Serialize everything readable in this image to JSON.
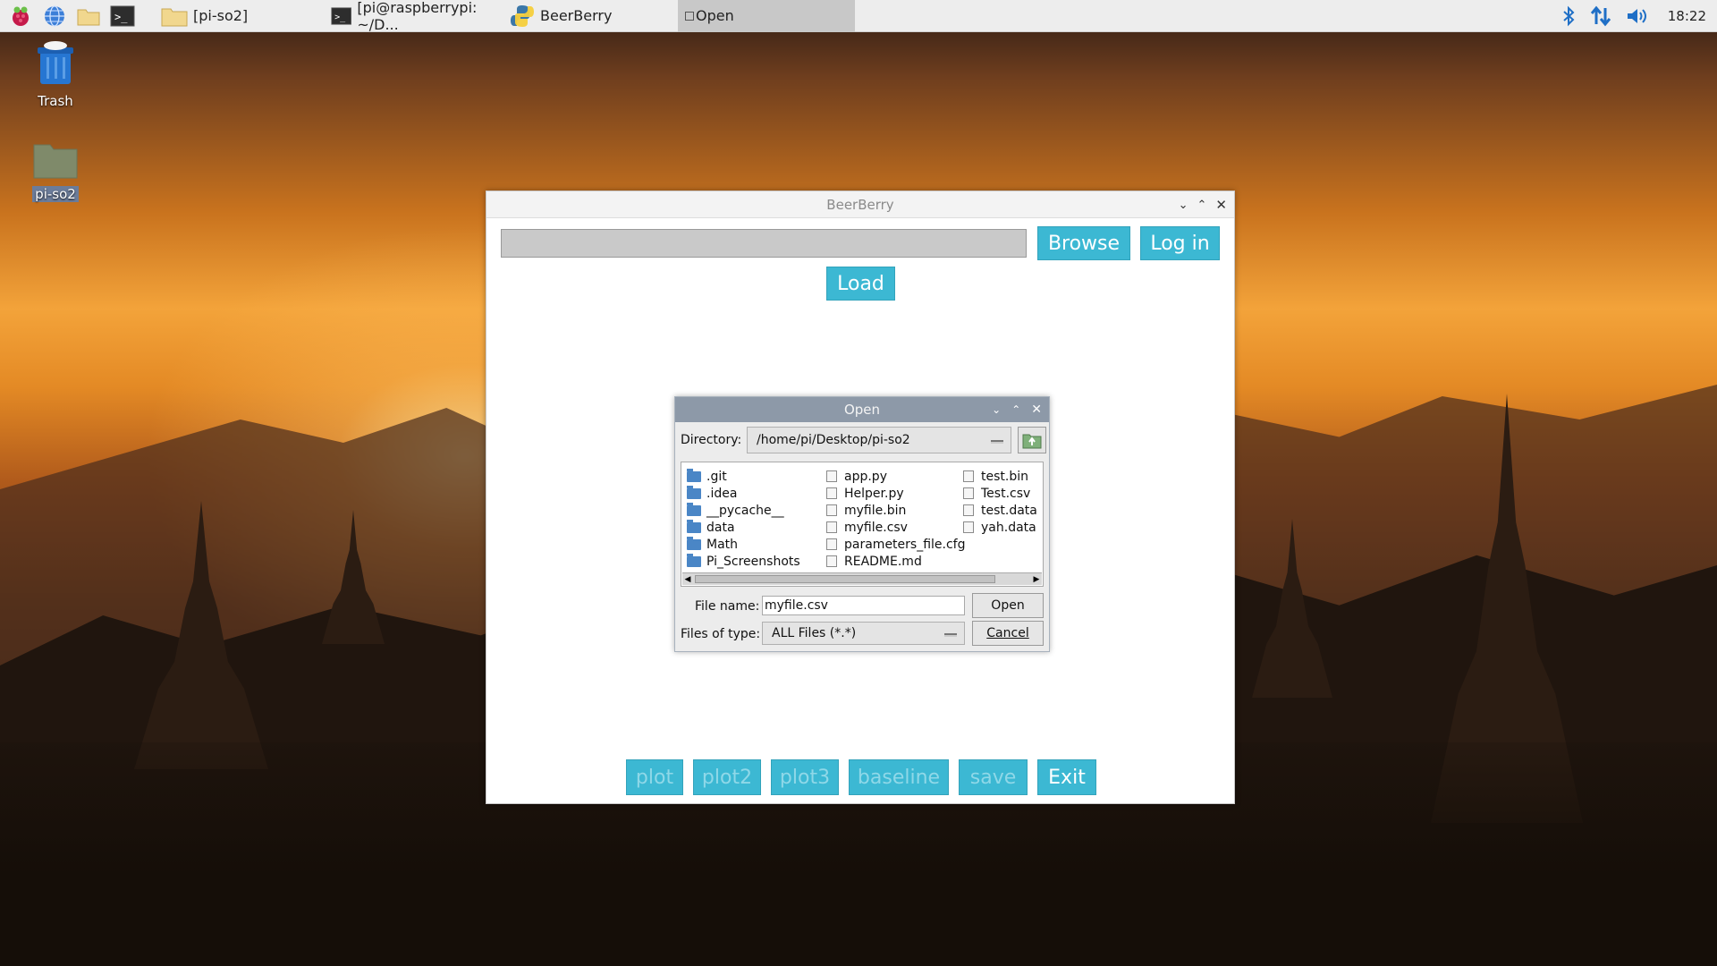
{
  "taskbar": {
    "tasks": [
      {
        "label": "[pi-so2]",
        "icon": "folder-icon"
      },
      {
        "label": "[pi@raspberrypi: ~/D...",
        "icon": "terminal-icon"
      },
      {
        "label": "BeerBerry",
        "icon": "python-icon"
      },
      {
        "label": "Open",
        "icon": "window-icon"
      }
    ],
    "clock": "18:22"
  },
  "desktop": {
    "icons": [
      {
        "label": "Trash",
        "icon": "trash-icon"
      },
      {
        "label": "pi-so2",
        "icon": "folder-icon"
      }
    ]
  },
  "beerberry": {
    "title": "BeerBerry",
    "path_value": "",
    "browse_label": "Browse",
    "login_label": "Log in",
    "load_label": "Load",
    "bottom_buttons": [
      {
        "label": "plot",
        "enabled": false
      },
      {
        "label": "plot2",
        "enabled": false
      },
      {
        "label": "plot3",
        "enabled": false
      },
      {
        "label": "baseline",
        "enabled": false
      },
      {
        "label": "save",
        "enabled": false
      },
      {
        "label": "Exit",
        "enabled": true
      }
    ]
  },
  "open_dialog": {
    "title": "Open",
    "directory_label": "Directory:",
    "directory_value": "/home/pi/Desktop/pi-so2",
    "folders": [
      ".git",
      ".idea",
      "__pycache__",
      "data",
      "Math",
      "Pi_Screenshots"
    ],
    "files_col2": [
      "app.py",
      "Helper.py",
      "myfile.bin",
      "myfile.csv",
      "parameters_file.cfg",
      "README.md"
    ],
    "files_col3": [
      "test.bin",
      "Test.csv",
      "test.data",
      "yah.data"
    ],
    "file_name_label": "File name:",
    "file_name_value": "myfile.csv",
    "files_of_type_label": "Files of type:",
    "files_of_type_value": "ALL Files (*.*)",
    "open_label": "Open",
    "cancel_label": "Cancel"
  }
}
